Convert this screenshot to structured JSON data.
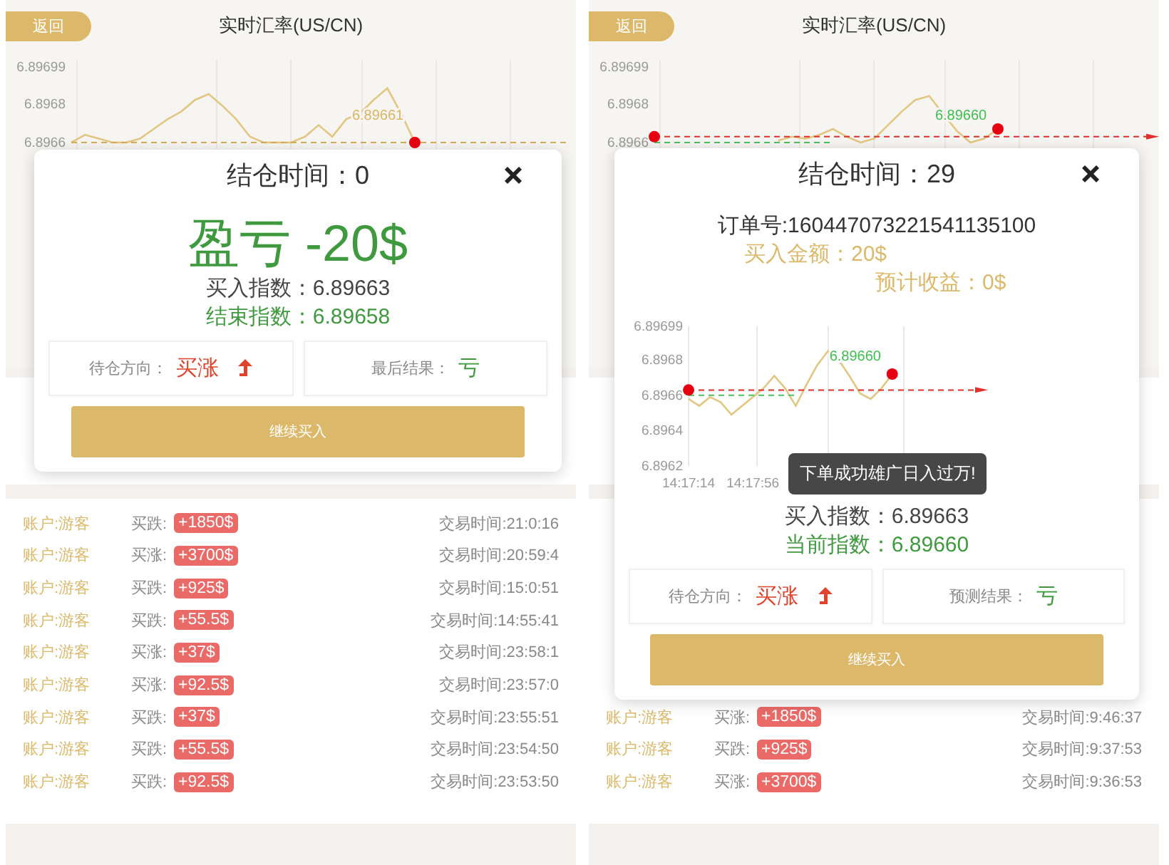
{
  "panels": [
    {
      "header": {
        "back": "返回",
        "title": "实时汇率(US/CN)"
      },
      "chart": {
        "chart_data": {
          "type": "line",
          "ylim": [
            6.8966,
            6.89699
          ],
          "grid": true,
          "yticks": [
            {
              "value": 6.89699,
              "label": "6.89699"
            },
            {
              "value": 6.8968,
              "label": "6.8968"
            },
            {
              "value": 6.8966,
              "label": "6.8966"
            }
          ],
          "categories": [
            null,
            null,
            null,
            null,
            null,
            null,
            null,
            null,
            null,
            null,
            null,
            null,
            null,
            null,
            null,
            null,
            null,
            null,
            null,
            null,
            null,
            null,
            null,
            null,
            null,
            null,
            null,
            null,
            null,
            null,
            null,
            null,
            null,
            null,
            null,
            null,
            null
          ],
          "series": [
            {
              "color": "#e2c782",
              "values": [
                6.8966,
                6.89664,
                6.89662,
                6.8966,
                6.8966,
                6.89662,
                6.89667,
                6.89672,
                6.89676,
                6.89682,
                6.89685,
                6.89679,
                6.89672,
                6.89663,
                6.8966,
                6.8966,
                6.8966,
                6.89663,
                6.89669,
                6.89663,
                6.89672,
                6.89675,
                6.89682,
                6.89688,
                6.89675,
                6.8966,
                null,
                null,
                null,
                null,
                null,
                null,
                null,
                null,
                null,
                null,
                null
              ]
            },
            {
              "color": "#d4ad55",
              "line_style": "dashed",
              "values": [
                6.8966,
                6.8966,
                6.8966,
                6.8966,
                6.8966,
                6.8966,
                6.8966,
                6.8966,
                6.8966,
                6.8966,
                6.8966,
                6.8966,
                6.8966,
                6.8966,
                6.8966,
                6.8966,
                6.8966,
                6.8966,
                6.8966,
                6.8966,
                6.8966,
                6.8966,
                6.8966,
                6.8966,
                6.8966,
                6.8966,
                6.8966,
                6.8966,
                6.8966,
                6.8966,
                6.8966,
                6.8966,
                6.8966,
                6.8966,
                6.8966,
                6.8966,
                6.8966
              ]
            }
          ]
        },
        "entry_marker": false,
        "price_label": {
          "text": "6.89661",
          "color": "#d9b565"
        }
      },
      "trades": [
        {
          "account": "账户:游客",
          "direction": "买跌:",
          "amount": "+1850$",
          "time": "交易时间:21:0:16"
        },
        {
          "account": "账户:游客",
          "direction": "买涨:",
          "amount": "+3700$",
          "time": "交易时间:20:59:4"
        },
        {
          "account": "账户:游客",
          "direction": "买跌:",
          "amount": "+925$",
          "time": "交易时间:15:0:51"
        },
        {
          "account": "账户:游客",
          "direction": "买跌:",
          "amount": "+55.5$",
          "time": "交易时间:14:55:41"
        },
        {
          "account": "账户:游客",
          "direction": "买涨:",
          "amount": "+37$",
          "time": "交易时间:23:58:1"
        },
        {
          "account": "账户:游客",
          "direction": "买涨:",
          "amount": "+92.5$",
          "time": "交易时间:23:57:0"
        },
        {
          "account": "账户:游客",
          "direction": "买跌:",
          "amount": "+37$",
          "time": "交易时间:23:55:51"
        },
        {
          "account": "账户:游客",
          "direction": "买跌:",
          "amount": "+55.5$",
          "time": "交易时间:23:54:50"
        },
        {
          "account": "账户:游客",
          "direction": "买跌:",
          "amount": "+92.5$",
          "time": "交易时间:23:53:50"
        }
      ],
      "dialog": {
        "kind": "settled",
        "title": "结仓时间：0",
        "pnl": "盈亏 -20$",
        "lines": [
          {
            "text": "买入指数：6.89663",
            "color": "#444444"
          },
          {
            "text": "结束指数：6.89658",
            "color": "#3f9a3f"
          }
        ],
        "boxes": [
          {
            "label": "待仓方向：",
            "value": "买涨",
            "color": "#e0432c",
            "arrow": true
          },
          {
            "label": "最后结果：",
            "value": "亏",
            "color": "#3f9a3f",
            "arrow": false
          }
        ],
        "button": "继续买入"
      }
    },
    {
      "header": {
        "back": "返回",
        "title": "实时汇率(US/CN)"
      },
      "chart": {
        "chart_data": {
          "type": "line",
          "ylim": [
            6.8966,
            6.89699
          ],
          "grid": true,
          "yticks": [
            {
              "value": 6.89699,
              "label": "6.89699"
            },
            {
              "value": 6.8968,
              "label": "6.8968"
            },
            {
              "value": 6.8966,
              "label": "6.8966"
            }
          ],
          "categories": [
            null,
            null,
            null,
            null,
            null,
            null,
            null,
            null,
            null,
            null,
            null,
            null,
            null,
            null,
            null,
            null,
            null,
            null,
            null,
            null,
            null,
            null,
            null,
            null,
            null,
            null,
            null,
            null,
            null,
            null,
            null,
            null,
            null,
            null,
            null,
            null,
            null
          ],
          "series": [
            {
              "color": "#e2c782",
              "values": [
                null,
                null,
                null,
                null,
                null,
                null,
                null,
                null,
                null,
                6.89661,
                6.89663,
                6.89662,
                6.89664,
                6.89667,
                6.89663,
                6.8966,
                6.89662,
                6.89669,
                6.89676,
                6.89682,
                6.89684,
                6.89675,
                6.89666,
                6.8966,
                6.89662,
                6.89667,
                null,
                null,
                null,
                null,
                null,
                null,
                null,
                null,
                null,
                null,
                null
              ]
            },
            {
              "color": "#e0302c",
              "line_style": "dashed",
              "values": [
                6.89663,
                6.89663,
                6.89663,
                6.89663,
                6.89663,
                6.89663,
                6.89663,
                6.89663,
                6.89663,
                6.89663,
                6.89663,
                6.89663,
                6.89663,
                6.89663,
                6.89663,
                6.89663,
                6.89663,
                6.89663,
                6.89663,
                6.89663,
                6.89663,
                6.89663,
                6.89663,
                6.89663,
                6.89663,
                6.89663,
                6.89663,
                6.89663,
                6.89663,
                6.89663,
                6.89663,
                6.89663,
                6.89663,
                6.89663,
                6.89663,
                6.89663,
                6.89663
              ]
            },
            {
              "color": "#4cc05c",
              "line_style": "dashed",
              "values": [
                6.8966,
                6.8966,
                6.8966,
                6.8966,
                6.8966,
                6.8966,
                6.8966,
                6.8966,
                6.8966,
                6.8966,
                6.8966,
                6.8966,
                6.8966,
                6.8966,
                null,
                null,
                null,
                null,
                null,
                null,
                null,
                null,
                null,
                null,
                null,
                null,
                null,
                null,
                null,
                null,
                null,
                null,
                null,
                null,
                null,
                null,
                null
              ]
            }
          ]
        },
        "entry_marker": true,
        "price_label": {
          "text": "6.89660",
          "color": "#3fbf4f"
        }
      },
      "trades": [
        {
          "account": "账户:游客",
          "direction": "买涨:",
          "amount": "+1850$",
          "time": "交易时间:9:46:37"
        },
        {
          "account": "账户:游客",
          "direction": "买跌:",
          "amount": "+925$",
          "time": "交易时间:9:37:53"
        },
        {
          "account": "账户:游客",
          "direction": "买涨:",
          "amount": "+3700$",
          "time": "交易时间:9:36:53"
        }
      ],
      "dialog": {
        "kind": "pending",
        "title": "结仓时间：29",
        "order": "订单号:160447073221541135100",
        "amount": "买入金额：20$",
        "expected": "预计收益：0$",
        "chart": {
          "chart_data": {
            "type": "line",
            "ylim": [
              6.8962,
              6.89699
            ],
            "grid": true,
            "yticks": [
              {
                "value": 6.89699,
                "label": "6.89699"
              },
              {
                "value": 6.8968,
                "label": "6.8968"
              },
              {
                "value": 6.8966,
                "label": "6.8966"
              },
              {
                "value": 6.8964,
                "label": "6.8964"
              },
              {
                "value": 6.8962,
                "label": "6.8962"
              }
            ],
            "categories": [
              "14:17:14",
              null,
              null,
              null,
              null,
              null,
              "14:17:56",
              null,
              null,
              null,
              null,
              null,
              null,
              null,
              null,
              null,
              null,
              null,
              null,
              null,
              null,
              null,
              null,
              null,
              null,
              null,
              null,
              null
            ],
            "series": [
              {
                "color": "#e2c782",
                "values": [
                  6.89658,
                  6.89654,
                  6.89659,
                  6.89656,
                  6.89649,
                  6.89654,
                  6.89659,
                  6.89664,
                  6.89671,
                  6.89664,
                  6.89654,
                  6.89666,
                  6.89677,
                  6.89685,
                  6.8968,
                  6.89671,
                  6.89661,
                  6.89658,
                  6.89664,
                  6.89672,
                  null,
                  null,
                  null,
                  null,
                  null,
                  null,
                  null,
                  null
                ]
              },
              {
                "color": "#e0302c",
                "line_style": "dashed",
                "values": [
                  6.89663,
                  6.89663,
                  6.89663,
                  6.89663,
                  6.89663,
                  6.89663,
                  6.89663,
                  6.89663,
                  6.89663,
                  6.89663,
                  6.89663,
                  6.89663,
                  6.89663,
                  6.89663,
                  6.89663,
                  6.89663,
                  6.89663,
                  6.89663,
                  6.89663,
                  6.89663,
                  6.89663,
                  6.89663,
                  6.89663,
                  6.89663,
                  6.89663,
                  6.89663,
                  6.89663,
                  6.89663
                ]
              },
              {
                "color": "#4cc05c",
                "line_style": "dashed",
                "values": [
                  6.8966,
                  6.8966,
                  6.8966,
                  6.8966,
                  6.8966,
                  6.8966,
                  6.8966,
                  6.8966,
                  6.8966,
                  6.8966,
                  6.8966,
                  null,
                  null,
                  null,
                  null,
                  null,
                  null,
                  null,
                  null,
                  null,
                  null,
                  null,
                  null,
                  null,
                  null,
                  null,
                  null,
                  null
                ]
              }
            ]
          },
          "entry_marker": true,
          "price_label": "6.89660"
        },
        "toast": "下单成功雄广日入过万!",
        "lines": [
          {
            "text": "买入指数：6.89663",
            "color": "#444444"
          },
          {
            "text": "当前指数：6.89660",
            "color": "#3f9a3f"
          }
        ],
        "boxes": [
          {
            "label": "待仓方向：",
            "value": "买涨",
            "color": "#e0432c",
            "arrow": true
          },
          {
            "label": "预测结果：",
            "value": "亏",
            "color": "#3f9a3f",
            "arrow": false
          }
        ],
        "button": "继续买入"
      }
    }
  ]
}
